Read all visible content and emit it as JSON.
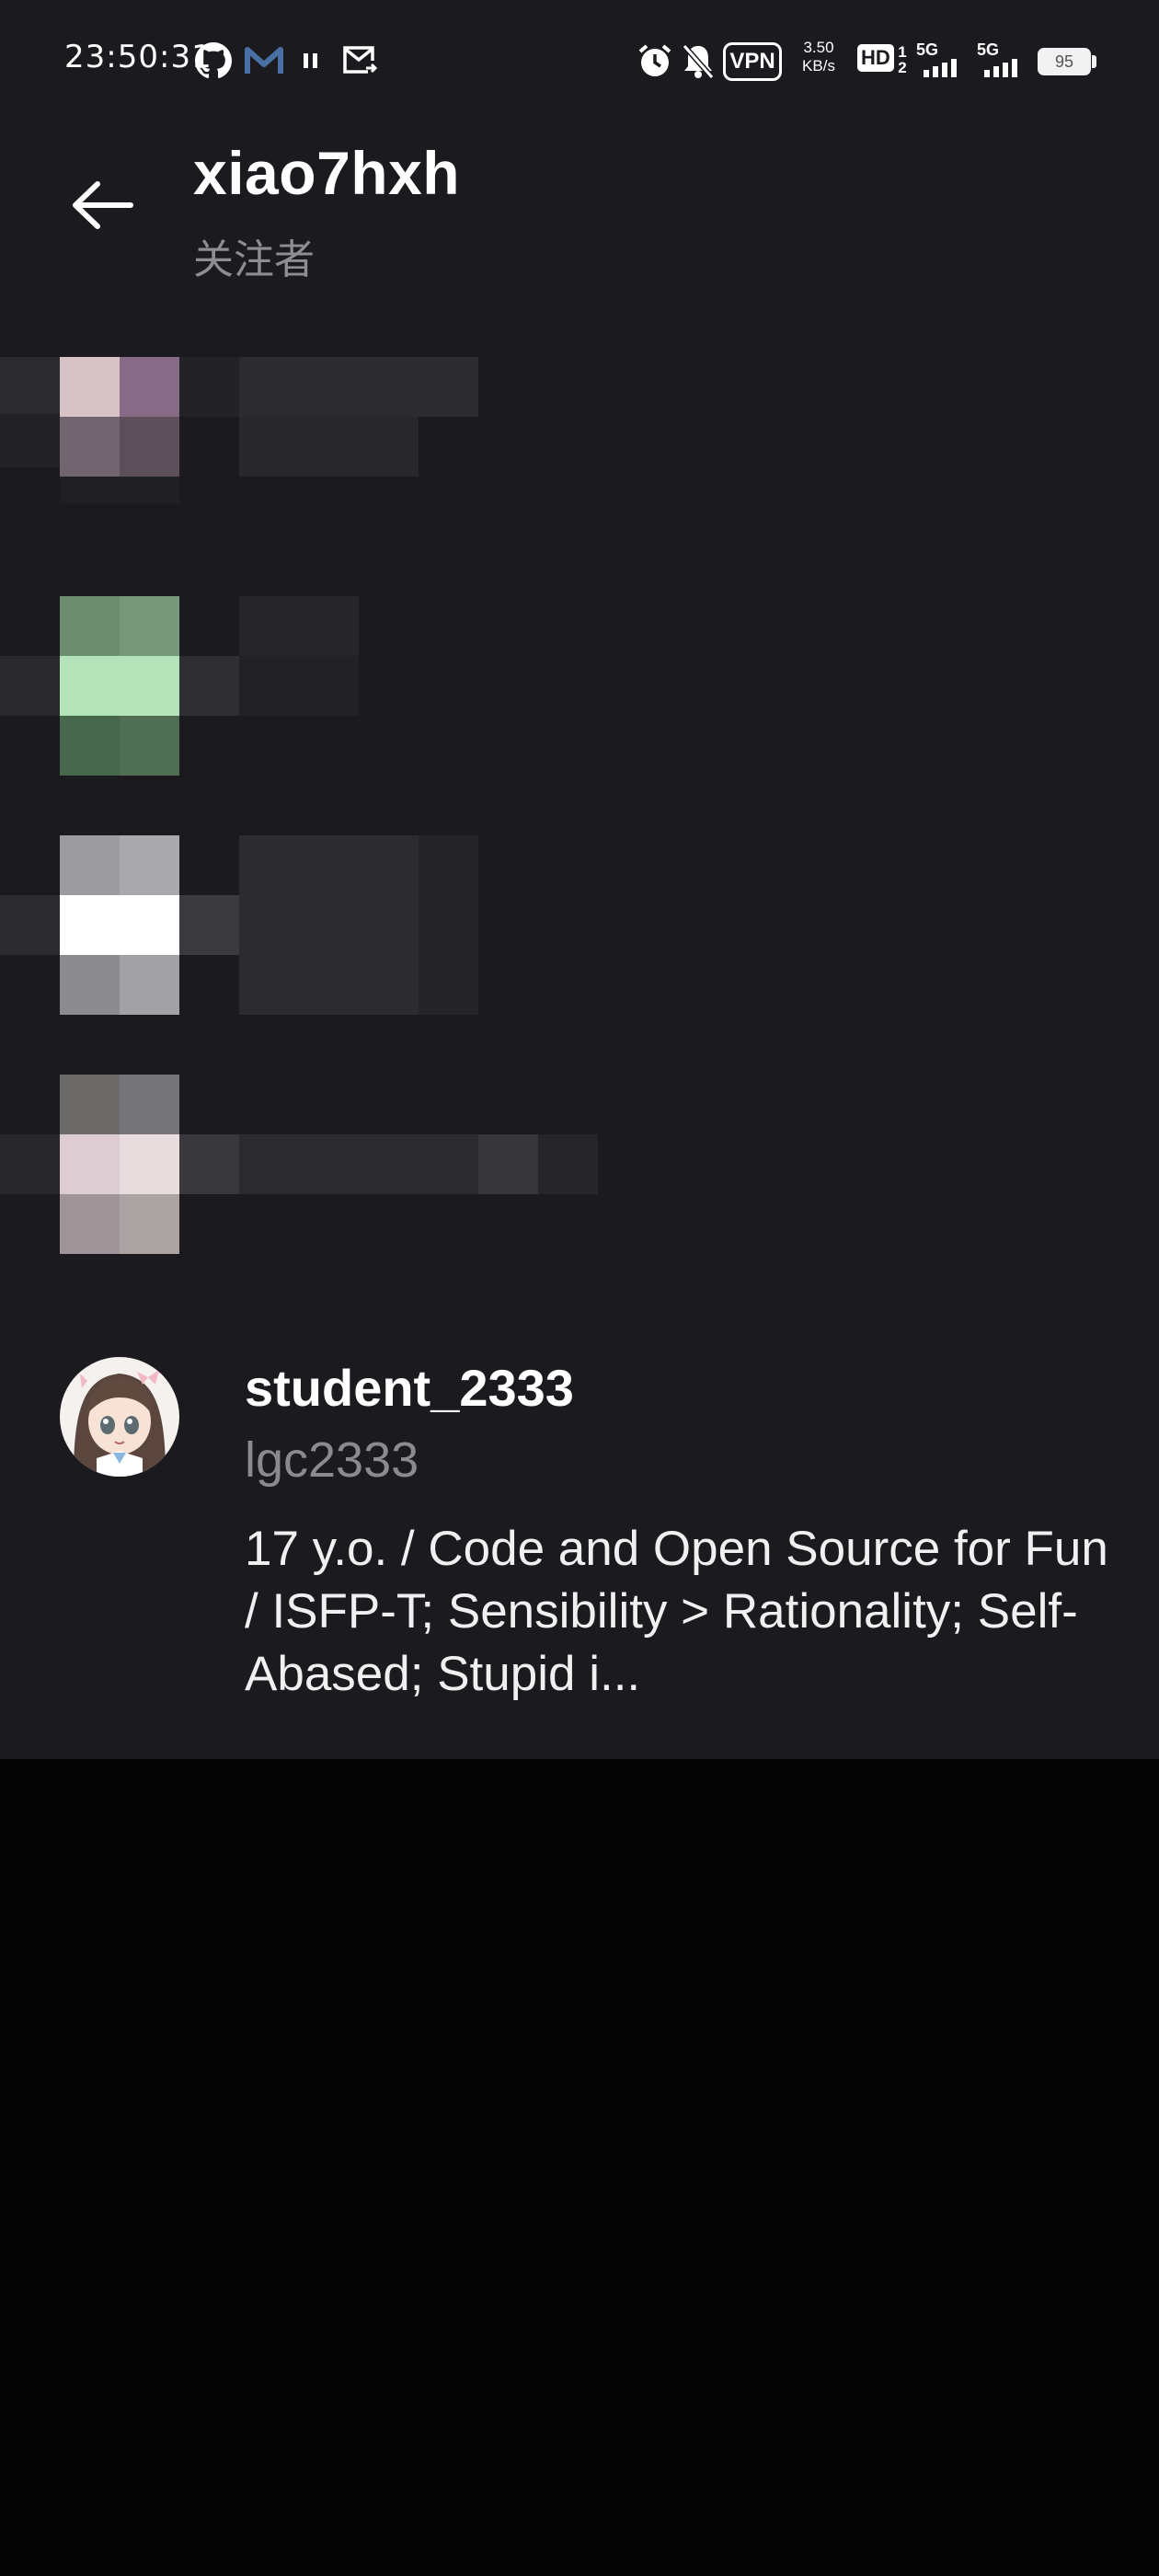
{
  "status_bar": {
    "time": "23:50:31",
    "net_speed_value": "3.50",
    "net_speed_unit": "KB/s",
    "vpn_label": "VPN",
    "hd_label": "HD",
    "hd_sub1": "1",
    "hd_sub2": "2",
    "sim1_label": "5G",
    "sim2_label": "5G",
    "battery_level": "95"
  },
  "header": {
    "title": "xiao7hxh",
    "subtitle": "关注者"
  },
  "users": [
    {
      "display_name": "student_2333",
      "handle": "lgc2333",
      "bio": "17 y.o. / Code and Open Source for Fun / ISFP-T; Sensibility > Rationality; Self-Abased; Stupid i..."
    }
  ],
  "colors": {
    "app_background": "#1b1b1f",
    "screen_background": "#050505",
    "primary_text": "#ffffff",
    "secondary_text": "#8d8d93"
  }
}
